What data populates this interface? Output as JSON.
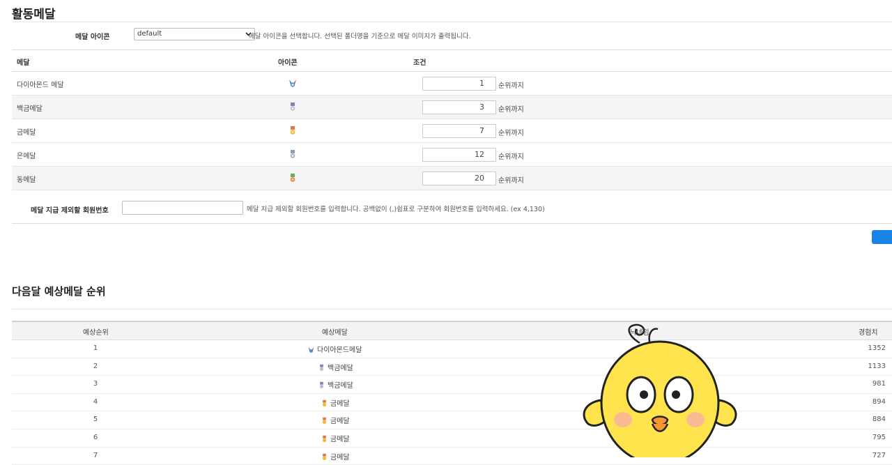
{
  "page": {
    "title": "활동메달"
  },
  "icon_setting": {
    "label": "메달 아이콘",
    "selected": "default",
    "help": "메달 아이콘을 선택합니다. 선택된 폴더명을 기준으로 메달 이미지가 출력됩니다."
  },
  "medal_table": {
    "headers": {
      "medal": "메달",
      "icon": "아이콘",
      "condition": "조건"
    },
    "suffix": "순위까지",
    "rows": [
      {
        "name": "다이아몬드 메달",
        "icon": "diamond-medal-icon",
        "rank": "1"
      },
      {
        "name": "백금메달",
        "icon": "platinum-medal-icon",
        "rank": "3"
      },
      {
        "name": "금메달",
        "icon": "gold-medal-icon",
        "rank": "7"
      },
      {
        "name": "은메달",
        "icon": "silver-medal-icon",
        "rank": "12"
      },
      {
        "name": "동메달",
        "icon": "bronze-medal-icon",
        "rank": "20"
      }
    ]
  },
  "exclude": {
    "label": "메달 지급 제외할 회원번호",
    "value": "",
    "help": "메달 지급 제외할 회원번호를 입력합니다. 공백없이 (,)쉼표로 구분하여 회원번호를 입력하세요. (ex 4,130)"
  },
  "ranking": {
    "title": "다음달 예상메달 순위",
    "headers": {
      "rank": "예상순위",
      "medal": "예상메달",
      "nickname": "닉네임",
      "exp": "경험치"
    },
    "rows": [
      {
        "rank": "1",
        "medal": "다이아몬드메달",
        "icon": "diamond-medal-icon",
        "exp": "1352"
      },
      {
        "rank": "2",
        "medal": "백금메달",
        "icon": "platinum-medal-icon",
        "exp": "1133"
      },
      {
        "rank": "3",
        "medal": "백금메달",
        "icon": "platinum-medal-icon",
        "exp": "981"
      },
      {
        "rank": "4",
        "medal": "금메달",
        "icon": "gold-medal-icon",
        "exp": "894"
      },
      {
        "rank": "5",
        "medal": "금메달",
        "icon": "gold-medal-icon",
        "exp": "884"
      },
      {
        "rank": "6",
        "medal": "금메달",
        "icon": "gold-medal-icon",
        "exp": "795"
      },
      {
        "rank": "7",
        "medal": "금메달",
        "icon": "gold-medal-icon",
        "exp": "727"
      }
    ]
  },
  "colors": {
    "primary_button": "#1a83e8",
    "gold": "#f5b82e",
    "silver": "#a9b3bd",
    "bronze": "#e0874a",
    "platinum": "#8f7fb8",
    "diamond": "#2f63b5",
    "chick_body": "#ffe44d"
  }
}
